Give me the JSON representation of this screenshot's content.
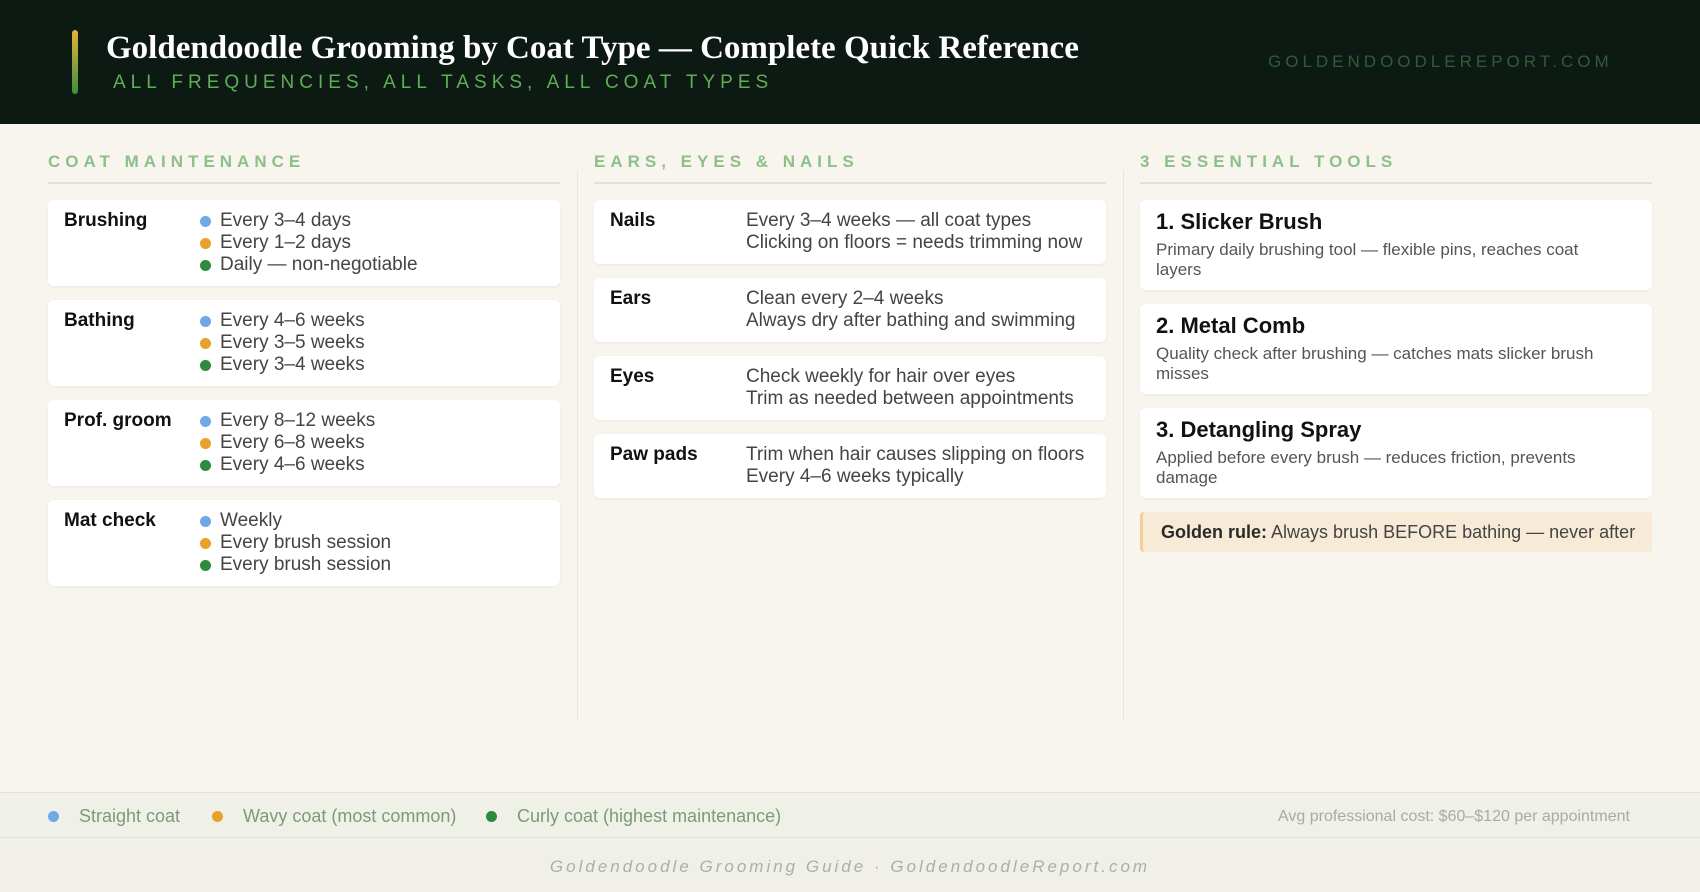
{
  "header": {
    "title": "Goldendoodle Grooming by Coat Type — Complete Quick Reference",
    "subtitle": "ALL FREQUENCIES, ALL TASKS, ALL COAT TYPES",
    "site": "GOLDENDOODLEREPORT.COM"
  },
  "colors": {
    "straight": "#6ea8e6",
    "wavy": "#e8a12a",
    "curly": "#2e8b3e"
  },
  "coat_maintenance": {
    "title": "COAT MAINTENANCE",
    "items": [
      {
        "label": "Brushing",
        "straight": "Every 3–4 days",
        "wavy": "Every 1–2 days",
        "curly": "Daily — non-negotiable"
      },
      {
        "label": "Bathing",
        "straight": "Every 4–6 weeks",
        "wavy": "Every 3–5 weeks",
        "curly": "Every 3–4 weeks"
      },
      {
        "label": "Prof. groom",
        "straight": "Every 8–12 weeks",
        "wavy": "Every 6–8 weeks",
        "curly": "Every 4–6 weeks"
      },
      {
        "label": "Mat check",
        "straight": "Weekly",
        "wavy": "Every brush session",
        "curly": "Every brush session"
      }
    ]
  },
  "ears_eyes_nails": {
    "title": "EARS, EYES & NAILS",
    "items": [
      {
        "label": "Nails",
        "line1": "Every 3–4 weeks — all coat types",
        "line2": "Clicking on floors = needs trimming now"
      },
      {
        "label": "Ears",
        "line1": "Clean every 2–4 weeks",
        "line2": "Always dry after bathing and swimming"
      },
      {
        "label": "Eyes",
        "line1": "Check weekly for hair over eyes",
        "line2": "Trim as needed between appointments"
      },
      {
        "label": "Paw pads",
        "line1": "Trim when hair causes slipping on floors",
        "line2": "Every 4–6 weeks typically"
      }
    ]
  },
  "tools": {
    "title": "3 ESSENTIAL TOOLS",
    "items": [
      {
        "name": "1. Slicker Brush",
        "desc": "Primary daily brushing tool — flexible pins, reaches coat layers"
      },
      {
        "name": "2. Metal Comb",
        "desc": "Quality check after brushing — catches mats slicker brush misses"
      },
      {
        "name": "3. Detangling Spray",
        "desc": "Applied before every brush — reduces friction, prevents damage"
      }
    ],
    "golden_rule_label": "Golden rule:",
    "golden_rule_text": "Always brush BEFORE bathing — never after"
  },
  "legend": {
    "straight": "Straight coat",
    "wavy": "Wavy coat (most common)",
    "curly": "Curly coat (highest maintenance)",
    "cost": "Avg professional cost: $60–$120 per appointment"
  },
  "footer": "Goldendoodle Grooming Guide · GoldendoodleReport.com"
}
